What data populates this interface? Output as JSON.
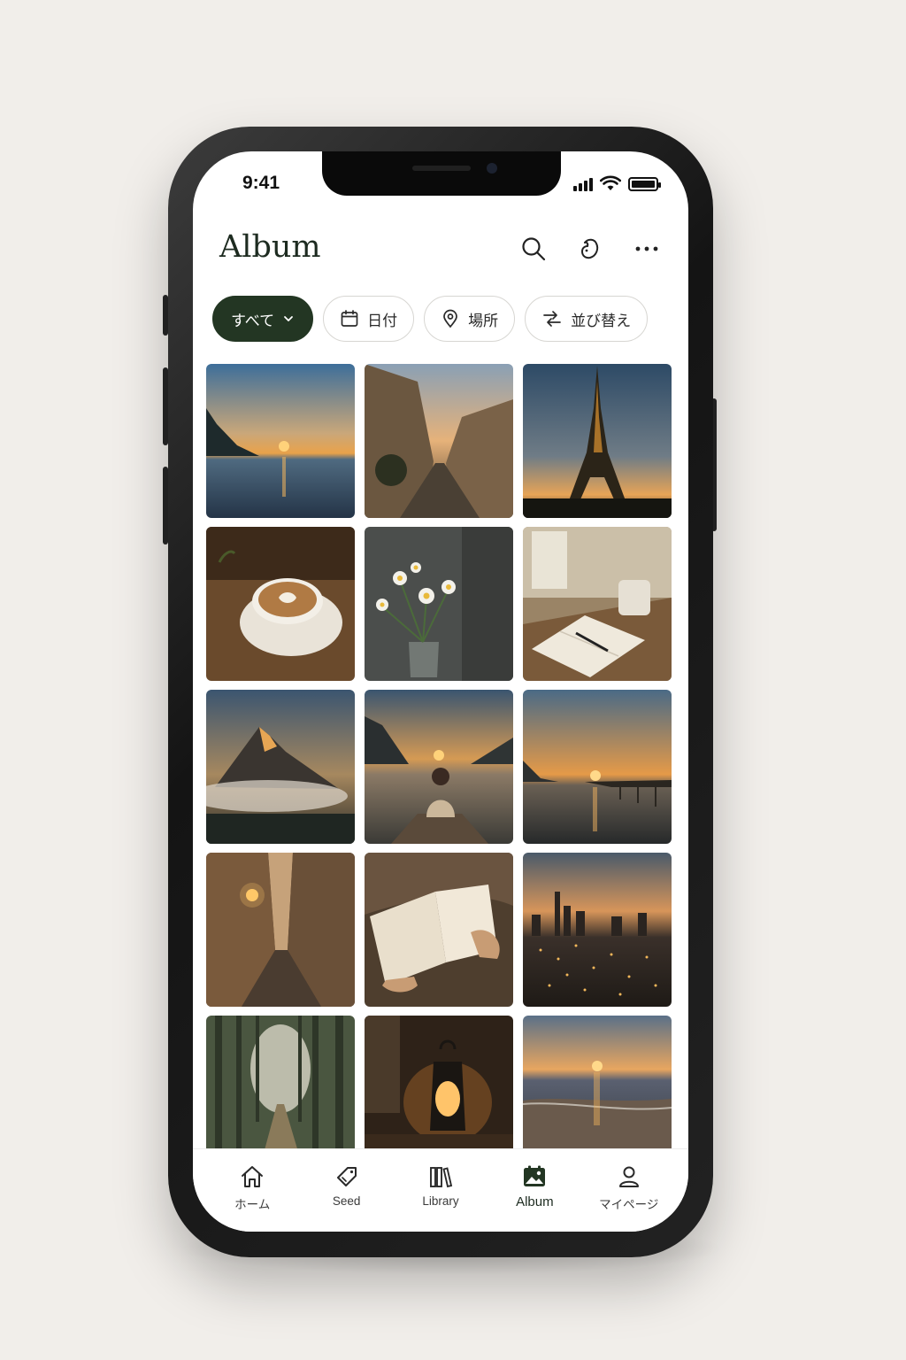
{
  "status_bar": {
    "time": "9:41"
  },
  "header": {
    "title": "Album"
  },
  "filters": [
    {
      "label": "すべて",
      "icon": "chevron-down-icon",
      "active": true
    },
    {
      "label": "日付",
      "icon": "calendar-icon",
      "active": false
    },
    {
      "label": "場所",
      "icon": "location-pin-icon",
      "active": false
    },
    {
      "label": "並び替え",
      "icon": "sort-icon",
      "active": false
    }
  ],
  "photos": [
    "lake-sunset",
    "european-street-dusk",
    "eiffel-tower-sunset",
    "latte-art-coffee",
    "daisies-in-vase",
    "notebook-by-window",
    "mountain-peak-fog",
    "person-on-dock",
    "pier-sunset",
    "cobblestone-alley-lamp",
    "open-book-hands",
    "city-lights-dusk",
    "misty-forest-path",
    "lantern-glow",
    "beach-sunset"
  ],
  "tabs": [
    {
      "label": "ホーム",
      "icon": "home-icon",
      "active": false
    },
    {
      "label": "Seed",
      "icon": "seed-tag-icon",
      "active": false
    },
    {
      "label": "Library",
      "icon": "library-books-icon",
      "active": false
    },
    {
      "label": "Album",
      "icon": "album-photo-icon",
      "active": true
    },
    {
      "label": "マイページ",
      "icon": "user-icon",
      "active": false
    }
  ],
  "colors": {
    "accent": "#233623",
    "background": "#f1eeea"
  }
}
